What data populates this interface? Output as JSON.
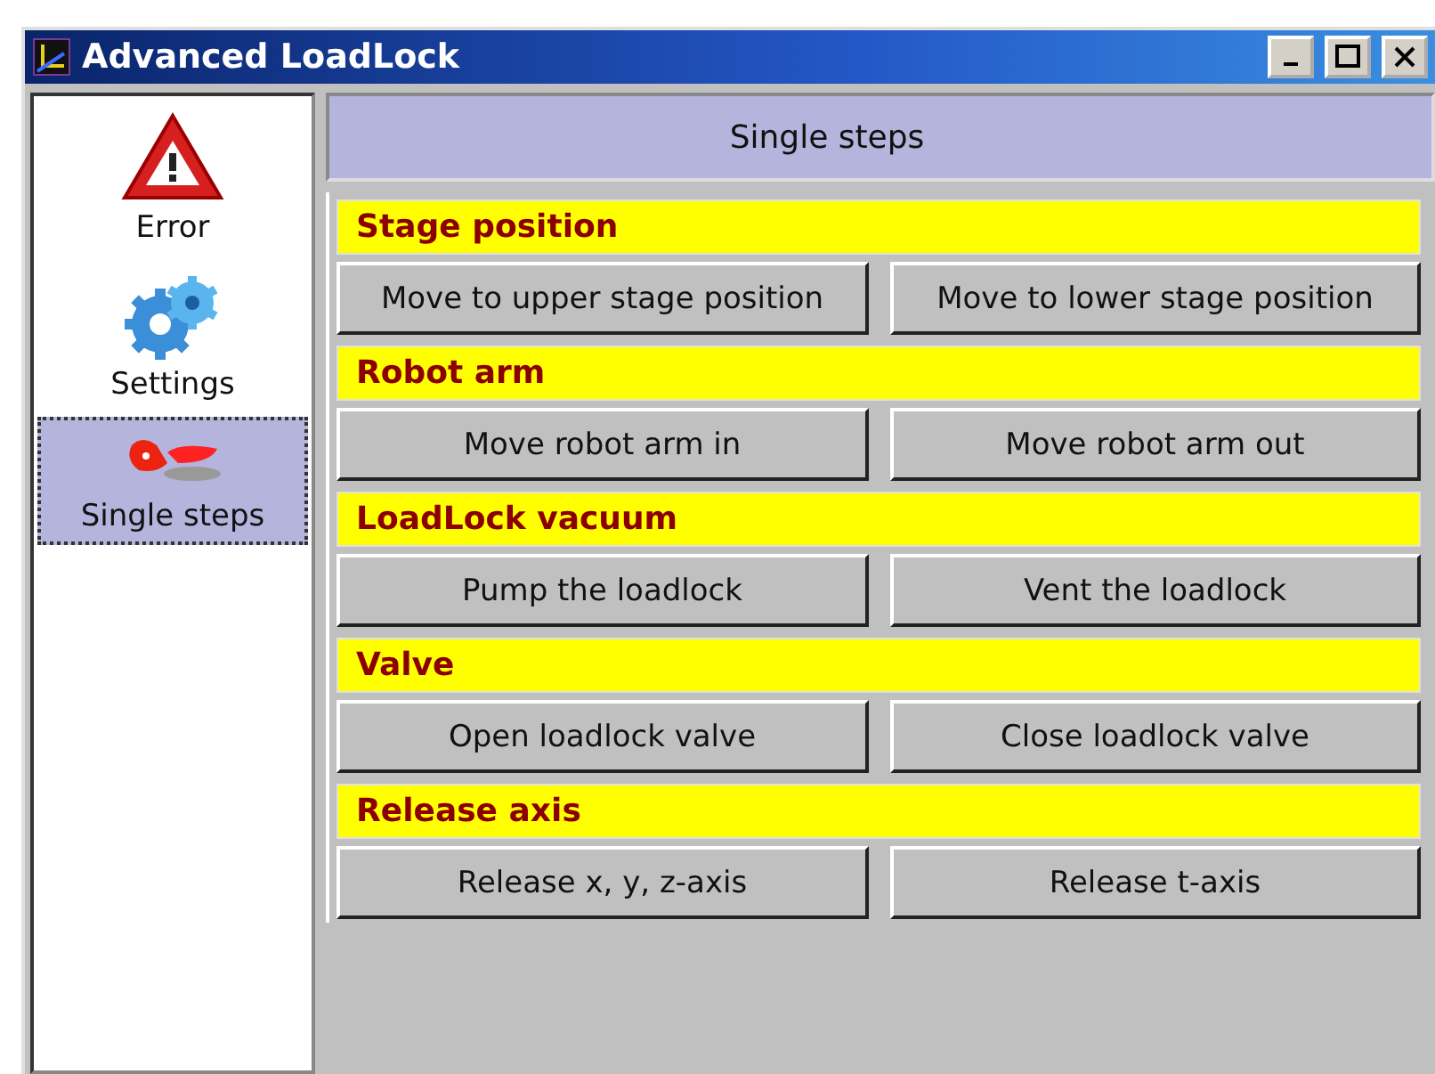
{
  "window": {
    "title": "Advanced LoadLock"
  },
  "sidebar": {
    "items": [
      {
        "label": "Error",
        "kind": "warning",
        "selected": false
      },
      {
        "label": "Settings",
        "kind": "gears",
        "selected": false
      },
      {
        "label": "Single steps",
        "kind": "shoes",
        "selected": true
      }
    ]
  },
  "panel_title": "Single steps",
  "sections": [
    {
      "title": "Stage position",
      "buttons": [
        "Move to upper stage position",
        "Move to lower stage position"
      ]
    },
    {
      "title": "Robot arm",
      "buttons": [
        "Move robot arm in",
        "Move robot arm out"
      ]
    },
    {
      "title": "LoadLock vacuum",
      "buttons": [
        "Pump the loadlock",
        "Vent the loadlock"
      ]
    },
    {
      "title": "Valve",
      "buttons": [
        "Open loadlock valve",
        "Close loadlock valve"
      ]
    },
    {
      "title": "Release axis",
      "buttons": [
        "Release x, y, z-axis",
        "Release t-axis"
      ]
    }
  ]
}
